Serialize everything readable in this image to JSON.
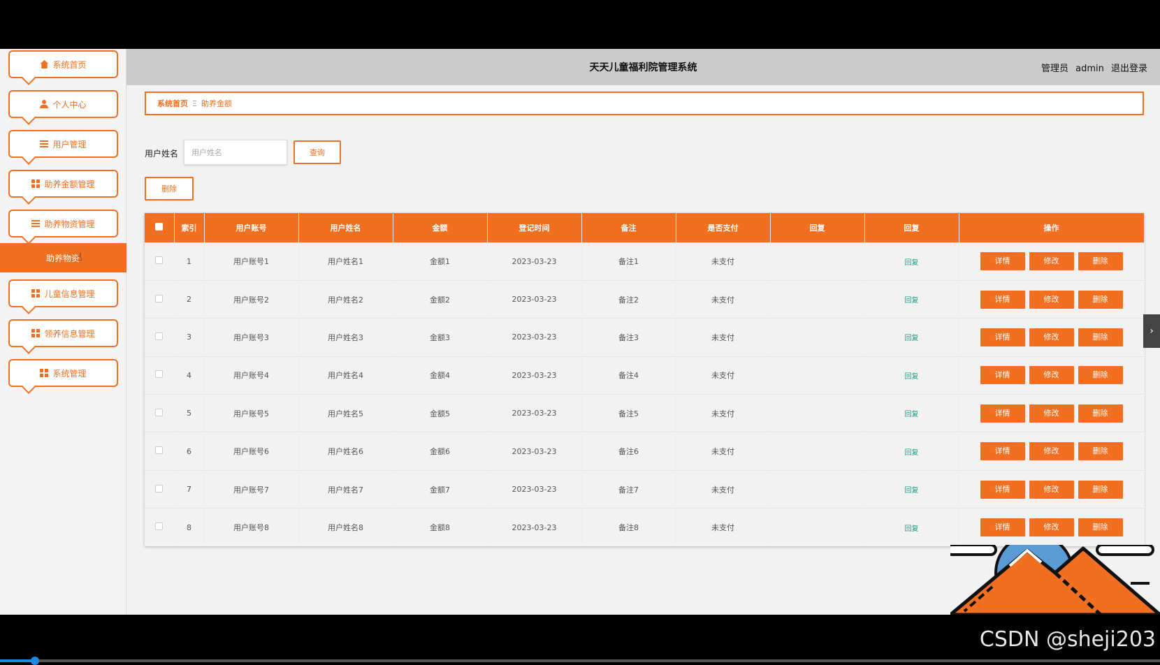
{
  "header": {
    "title": "天天儿童福利院管理系统",
    "role": "管理员",
    "username": "admin",
    "logout": "退出登录"
  },
  "sidebar": {
    "items": [
      {
        "label": "系统首页",
        "icon": "home-icon"
      },
      {
        "label": "个人中心",
        "icon": "user-icon"
      },
      {
        "label": "用户管理",
        "icon": "sliders-icon"
      },
      {
        "label": "助养金额管理",
        "icon": "grid-icon"
      },
      {
        "label": "助养物资管理",
        "icon": "list-icon"
      },
      {
        "label": "儿童信息管理",
        "icon": "grid-icon"
      },
      {
        "label": "领养信息管理",
        "icon": "grid-icon"
      },
      {
        "label": "系统管理",
        "icon": "grid-icon"
      }
    ],
    "active_sub": "助养物资"
  },
  "breadcrumb": {
    "home": "系统首页",
    "separator": "Ξ",
    "current": "助养金额"
  },
  "search": {
    "label": "用户姓名",
    "placeholder": "用户姓名",
    "value": "",
    "button": "查询"
  },
  "toolbar": {
    "delete_label": "删除"
  },
  "table": {
    "headers": [
      "索引",
      "用户账号",
      "用户姓名",
      "金额",
      "登记时间",
      "备注",
      "是否支付",
      "回复",
      "回复",
      "操作"
    ],
    "reply_link": "回复",
    "actions": [
      "详情",
      "修改",
      "删除"
    ],
    "rows": [
      {
        "index": "1",
        "account": "用户账号1",
        "name": "用户姓名1",
        "amount": "金额1",
        "time": "2023-03-23",
        "note": "备注1",
        "paid": "未支付"
      },
      {
        "index": "2",
        "account": "用户账号2",
        "name": "用户姓名2",
        "amount": "金额2",
        "time": "2023-03-23",
        "note": "备注2",
        "paid": "未支付"
      },
      {
        "index": "3",
        "account": "用户账号3",
        "name": "用户姓名3",
        "amount": "金额3",
        "time": "2023-03-23",
        "note": "备注3",
        "paid": "未支付"
      },
      {
        "index": "4",
        "account": "用户账号4",
        "name": "用户姓名4",
        "amount": "金额4",
        "time": "2023-03-23",
        "note": "备注4",
        "paid": "未支付"
      },
      {
        "index": "5",
        "account": "用户账号5",
        "name": "用户姓名5",
        "amount": "金额5",
        "time": "2023-03-23",
        "note": "备注5",
        "paid": "未支付"
      },
      {
        "index": "6",
        "account": "用户账号6",
        "name": "用户姓名6",
        "amount": "金额6",
        "time": "2023-03-23",
        "note": "备注6",
        "paid": "未支付"
      },
      {
        "index": "7",
        "account": "用户账号7",
        "name": "用户姓名7",
        "amount": "金额7",
        "time": "2023-03-23",
        "note": "备注7",
        "paid": "未支付"
      },
      {
        "index": "8",
        "account": "用户账号8",
        "name": "用户姓名8",
        "amount": "金额8",
        "time": "2023-03-23",
        "note": "备注8",
        "paid": "未支付"
      }
    ]
  },
  "watermark": "CSDN @sheji203",
  "video_progress": 0.03,
  "colors": {
    "accent": "#f26f21",
    "reply": "#16a085",
    "header_bg": "#cbcbcb"
  }
}
